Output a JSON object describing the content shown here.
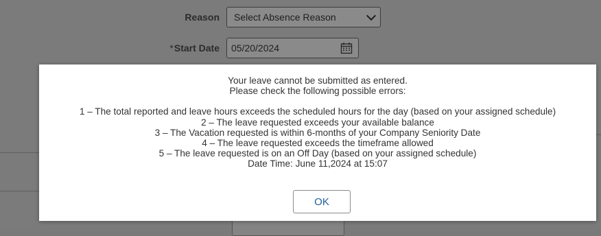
{
  "form": {
    "reason_label": "Reason",
    "reason_value": "Select Absence Reason",
    "start_date_required": "*",
    "start_date_label": "Start Date",
    "start_date_value": "05/20/2024"
  },
  "modal": {
    "lines": [
      "Your leave cannot be submitted as entered.",
      "Please check the following possible errors:",
      "",
      "1 – The total reported and leave hours exceeds the scheduled hours for the day (based on your assigned schedule)",
      "2 – The leave requested exceeds your available balance",
      "3 – The Vacation requested is within 6-months of your Company Seniority Date",
      "4 – The leave requested exceeds the timeframe allowed",
      "5 – The leave requested is on an Off Day (based on your assigned schedule)",
      "Date Time: June 11,2024 at 15:07"
    ],
    "ok_label": "OK"
  },
  "icons": {
    "reason_dropdown": "chevron-down-icon",
    "start_date_picker": "calendar-icon"
  }
}
